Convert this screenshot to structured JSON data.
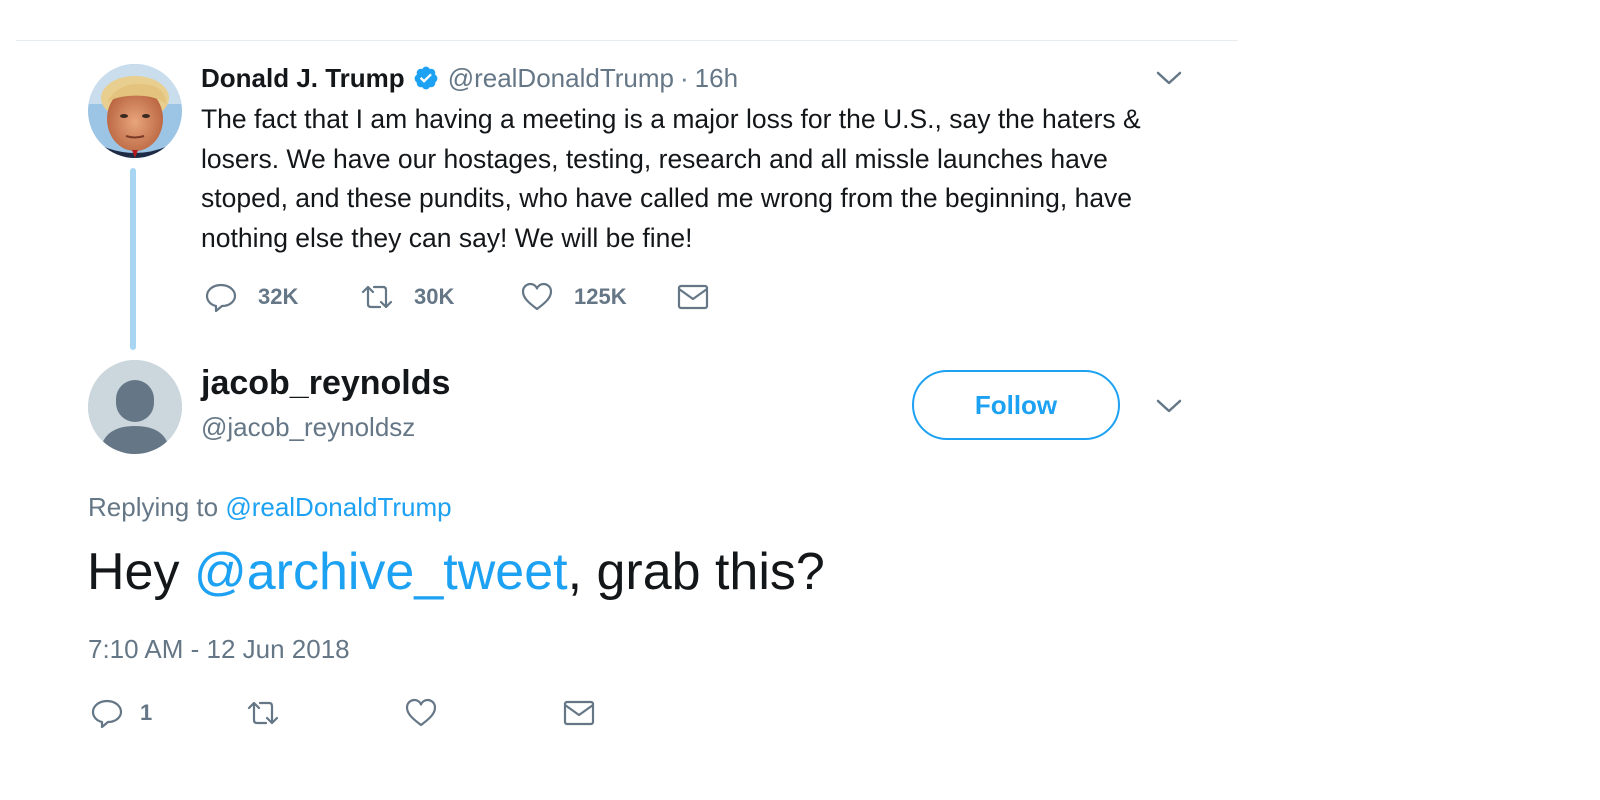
{
  "parent_tweet": {
    "author_name": "Donald J. Trump",
    "author_handle": "@realDonaldTrump",
    "separator": "·",
    "time": "16h",
    "text": "The fact that I am having a meeting is a major loss for the U.S., say the haters & losers. We have our hostages, testing, research and all missle launches have stoped, and these pundits, who have called me wrong from the beginning, have nothing else they can say! We will be fine!",
    "reply_count": "32K",
    "retweet_count": "30K",
    "like_count": "125K",
    "avatar_icon": "trump-avatar-photo",
    "verified_icon": "verified-badge-icon"
  },
  "reply_tweet": {
    "author_name": "jacob_reynolds",
    "author_handle": "@jacob_reynoldsz",
    "follow_label": "Follow",
    "replying_to_prefix": "Replying to",
    "replying_to_handle": "@realDonaldTrump",
    "text_prefix": "Hey",
    "mention": "@archive_tweet",
    "text_suffix": ", grab this?",
    "timestamp": "7:10 AM - 12 Jun 2018",
    "reply_count": "1",
    "avatar_icon": "default-avatar-icon"
  },
  "colors": {
    "link": "#1da1f2",
    "secondary_text": "#657786",
    "primary_text": "#14171a",
    "thread_line": "#a7d5f2"
  }
}
